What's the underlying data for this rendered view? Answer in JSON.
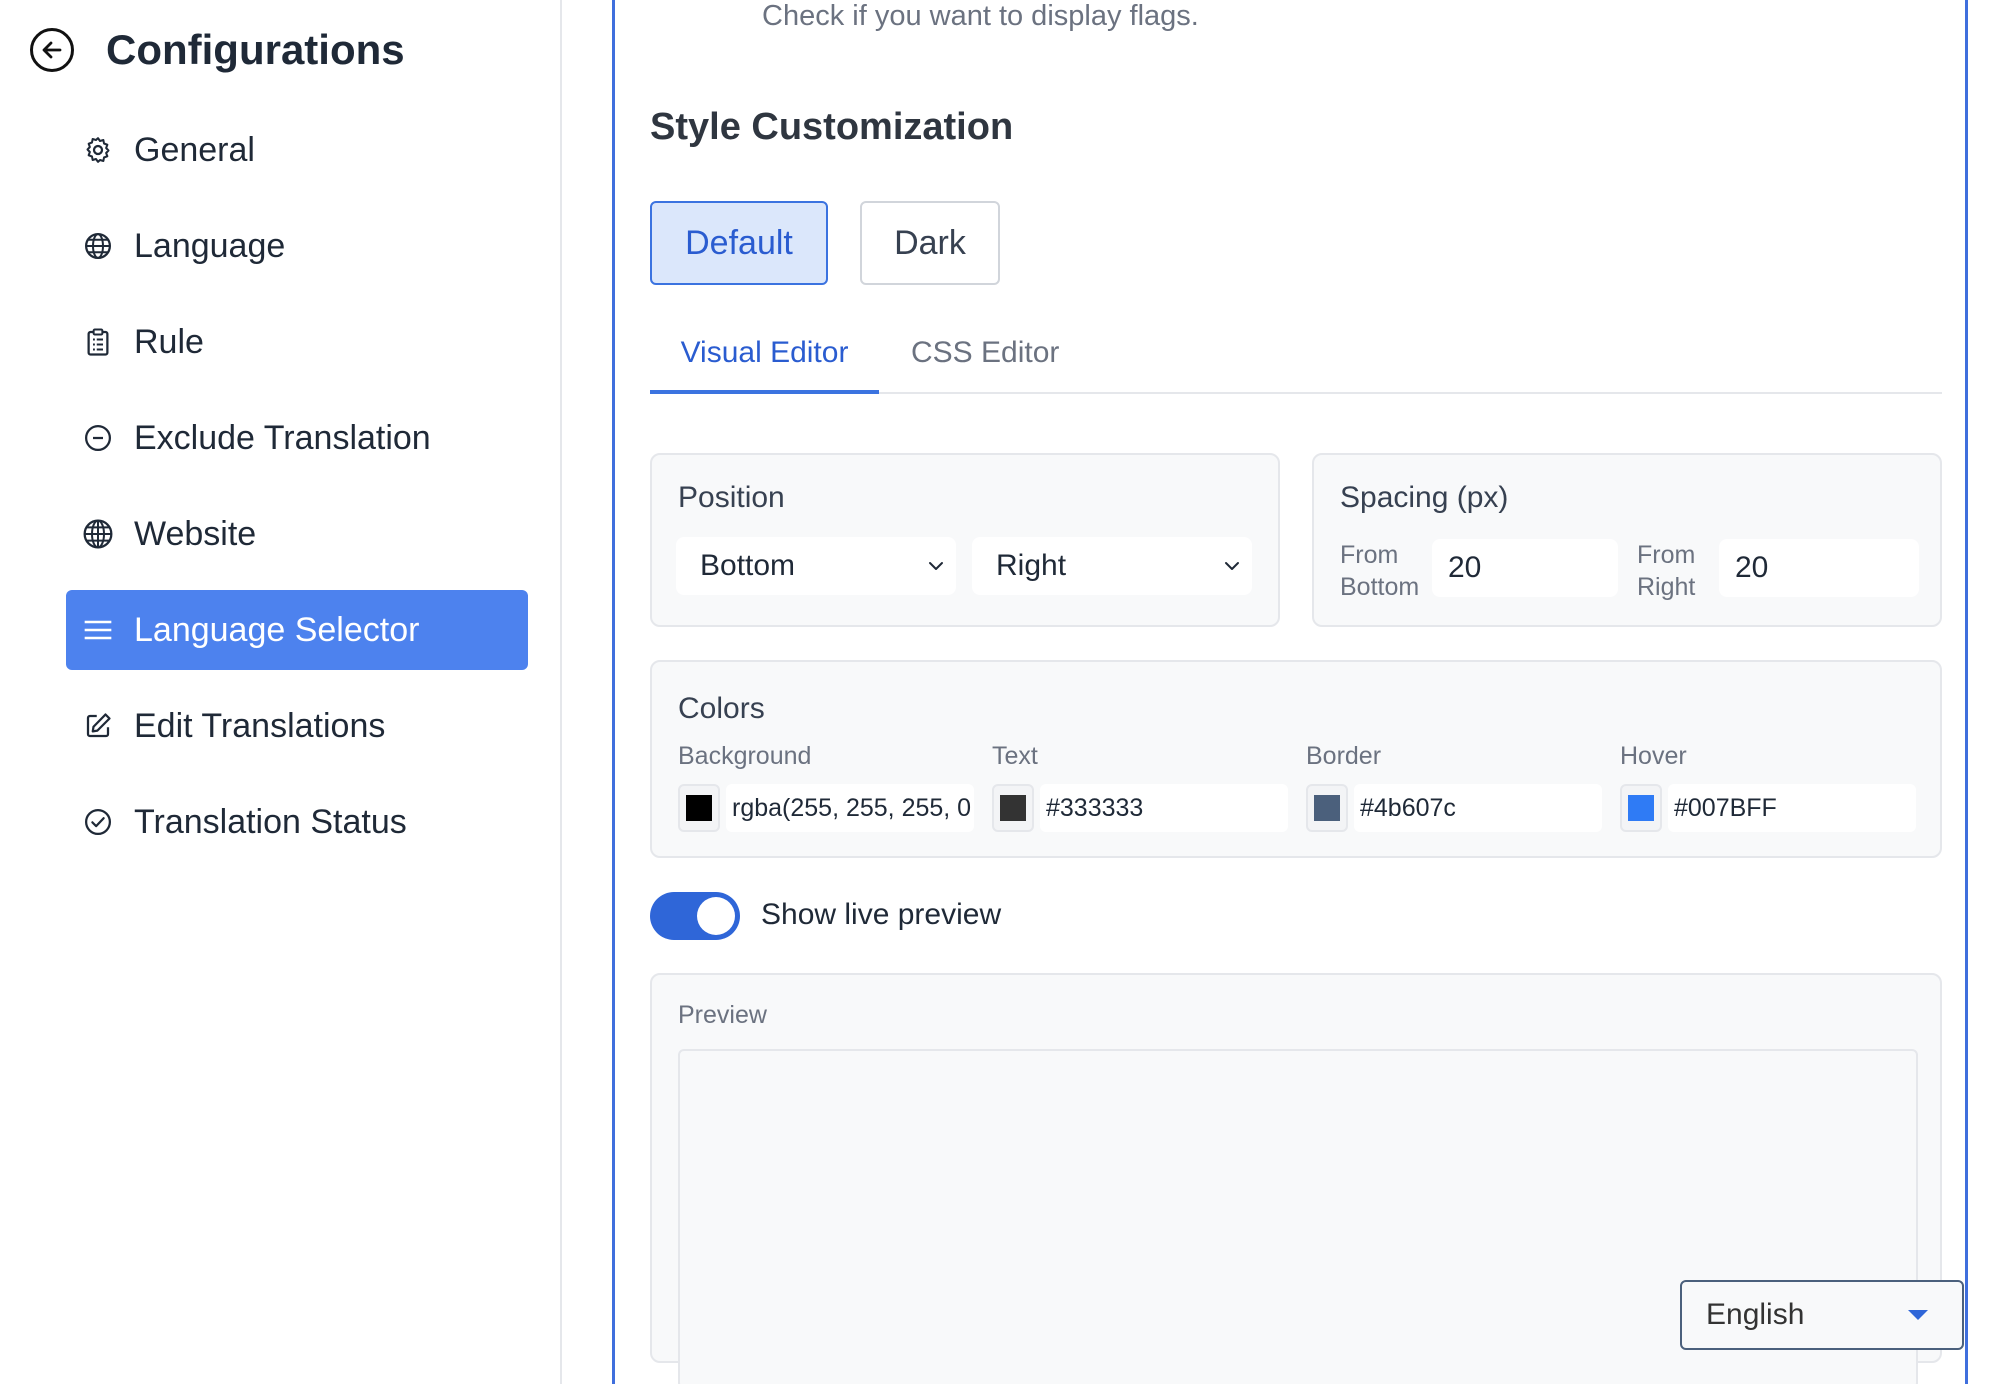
{
  "sidebar": {
    "title": "Configurations",
    "back_icon": "arrow-left-circle-icon",
    "items": [
      {
        "label": "General",
        "icon": "gear-icon",
        "active": false
      },
      {
        "label": "Language",
        "icon": "globe-icon",
        "active": false
      },
      {
        "label": "Rule",
        "icon": "clipboard-list-icon",
        "active": false
      },
      {
        "label": "Exclude Translation",
        "icon": "minus-circle-icon",
        "active": false
      },
      {
        "label": "Website",
        "icon": "globe-grid-icon",
        "active": false
      },
      {
        "label": "Language Selector",
        "icon": "menu-lines-icon",
        "active": true
      },
      {
        "label": "Edit Translations",
        "icon": "edit-icon",
        "active": false
      },
      {
        "label": "Translation Status",
        "icon": "check-circle-icon",
        "active": false
      }
    ]
  },
  "main": {
    "flags_hint": "Check if you want to display flags.",
    "section_title": "Style Customization",
    "themes": {
      "default": "Default",
      "dark": "Dark",
      "selected": "Default"
    },
    "tabs": {
      "visual": "Visual Editor",
      "css": "CSS Editor",
      "active": "Visual Editor"
    },
    "position": {
      "label": "Position",
      "vertical": "Bottom",
      "horizontal": "Right"
    },
    "spacing": {
      "label": "Spacing (px)",
      "from_bottom_label": "From Bottom",
      "from_bottom_value": "20",
      "from_right_label": "From Right",
      "from_right_value": "20"
    },
    "colors": {
      "label": "Colors",
      "background": {
        "label": "Background",
        "value": "rgba(255, 255, 255, 0",
        "swatch": "#000000"
      },
      "text": {
        "label": "Text",
        "value": "#333333",
        "swatch": "#333333"
      },
      "border": {
        "label": "Border",
        "value": "#4b607c",
        "swatch": "#4b607c"
      },
      "hover": {
        "label": "Hover",
        "value": "#007BFF",
        "swatch": "#2f7bf5"
      }
    },
    "live_preview": {
      "label": "Show live preview",
      "enabled": true
    },
    "preview": {
      "label": "Preview",
      "selector_value": "English"
    }
  },
  "accent_color": "#4d82ee"
}
